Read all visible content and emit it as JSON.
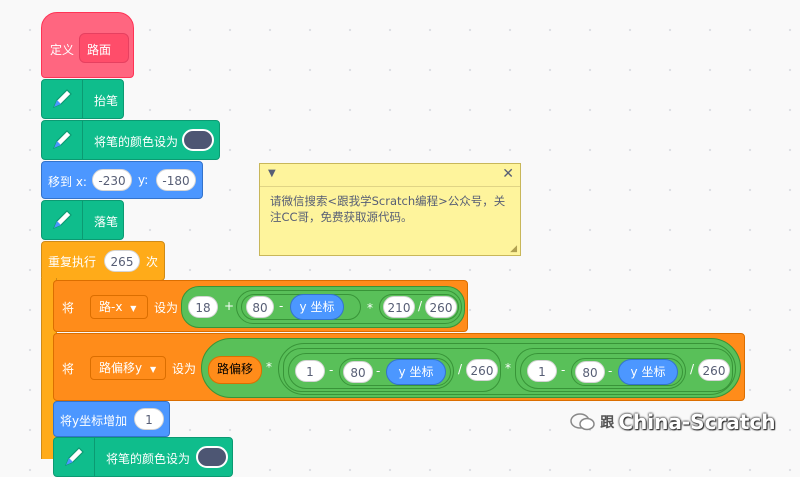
{
  "define": {
    "keyword": "定义",
    "name": "路面"
  },
  "pen_up": {
    "label": "抬笔"
  },
  "set_pen_color_1": {
    "label": "将笔的颜色设为",
    "color": "#4d5673"
  },
  "goto": {
    "label_x": "移到 x:",
    "x": "-230",
    "label_y": "y:",
    "y": "-180"
  },
  "pen_down": {
    "label": "落笔"
  },
  "repeat": {
    "label": "重复执行",
    "count": "265",
    "suffix": "次"
  },
  "set1": {
    "label_set": "将",
    "var": "路-x",
    "label_to": "设为",
    "a": "18",
    "plus": "+",
    "b": "80",
    "minus": "-",
    "reporter": "y 坐标",
    "times": "*",
    "c": "210",
    "div": "/",
    "d": "260"
  },
  "set2": {
    "label_set": "将",
    "var": "路偏移y",
    "label_to": "设为",
    "var_reporter": "路偏移",
    "times1": "*",
    "one_a": "1",
    "minus_a": "-",
    "e80a": "80",
    "minus_b": "-",
    "reporter_a": "y 坐标",
    "div_a": "/",
    "d260a": "260",
    "times2": "*",
    "one_b": "1",
    "minus_c": "-",
    "e80b": "80",
    "minus_d": "-",
    "reporter_b": "y 坐标",
    "div_b": "/",
    "d260b": "260"
  },
  "change": {
    "label": "将y坐标增加",
    "value": "1"
  },
  "set_pen_color_2": {
    "label": "将笔的颜色设为"
  },
  "note": {
    "text": "请微信搜索<跟我学Scratch编程>公众号，关注CC哥，免费获取源代码。"
  },
  "watermark": {
    "prefix": "跟",
    "brand": "China-Scratch"
  }
}
